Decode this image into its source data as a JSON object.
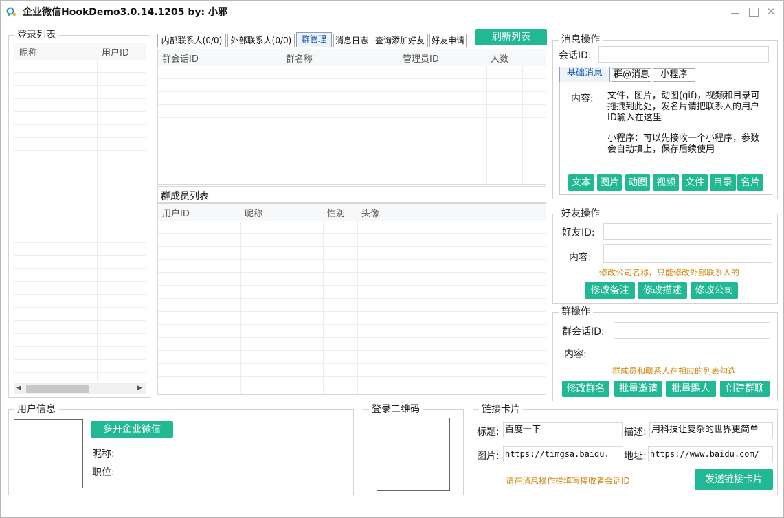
{
  "window": {
    "title": "企业微信HookDemo3.0.14.1205 by: 小邪",
    "close_glyph": "✕"
  },
  "login_list": {
    "title": "登录列表",
    "columns": [
      "昵称",
      "用户ID"
    ]
  },
  "tabs": [
    "内部联系人(0/0)",
    "外部联系人(0/0)",
    "群管理",
    "消息日志",
    "查询添加好友",
    "好友申请"
  ],
  "refresh_label": "刷新列表",
  "group_table": {
    "columns": [
      "群会话ID",
      "群名称",
      "管理员ID",
      "人数"
    ]
  },
  "member_list": {
    "title": "群成员列表",
    "columns": [
      "用户ID",
      "昵称",
      "性别",
      "头像"
    ]
  },
  "message_ops": {
    "title": "消息操作",
    "session_label": "会话ID:",
    "session_value": "",
    "tabs": [
      "基础消息",
      "群@消息",
      "小程序"
    ],
    "content_label": "内容:",
    "content_text_1": "文件，图片，动图(gif)，视频和目录可拖拽到此处，发名片请把联系人的用户ID输入在这里",
    "content_text_2": "小程序：可以先接收一个小程序，参数会自动填上，保存后续使用",
    "buttons": [
      "文本",
      "图片",
      "动图",
      "视频",
      "文件",
      "目录",
      "名片"
    ]
  },
  "friend_ops": {
    "title": "好友操作",
    "id_label": "好友ID:",
    "id_value": "",
    "content_label": "内容:",
    "content_value": "",
    "hint": "修改公司名称，只能修改外部联系人的",
    "buttons": [
      "修改备注",
      "修改描述",
      "修改公司"
    ]
  },
  "group_ops": {
    "title": "群操作",
    "id_label": "群会话ID:",
    "id_value": "",
    "content_label": "内容:",
    "content_value": "",
    "hint": "群成员和联系人在相应的列表勾选",
    "buttons": [
      "修改群名",
      "批量邀请",
      "批量踢人",
      "创建群聊"
    ]
  },
  "user_info": {
    "title": "用户信息",
    "multi_open": "多开企业微信",
    "nickname_label": "昵称:",
    "position_label": "职位:"
  },
  "qr": {
    "title": "登录二维码"
  },
  "link_card": {
    "title": "链接卡片",
    "title_label": "标题:",
    "title_value": "百度一下",
    "desc_label": "描述:",
    "desc_value": "用科技让复杂的世界更简单",
    "image_label": "图片:",
    "image_value": "https://timgsa.baidu.",
    "url_label": "地址:",
    "url_value": "https://www.baidu.com/",
    "hint": "请在消息操作栏填写接收者会话ID",
    "send": "发送链接卡片"
  },
  "colors": {
    "accent": "#21b993",
    "hint": "#d4880e"
  },
  "icons": {
    "app": "wecom-logo-icon"
  }
}
